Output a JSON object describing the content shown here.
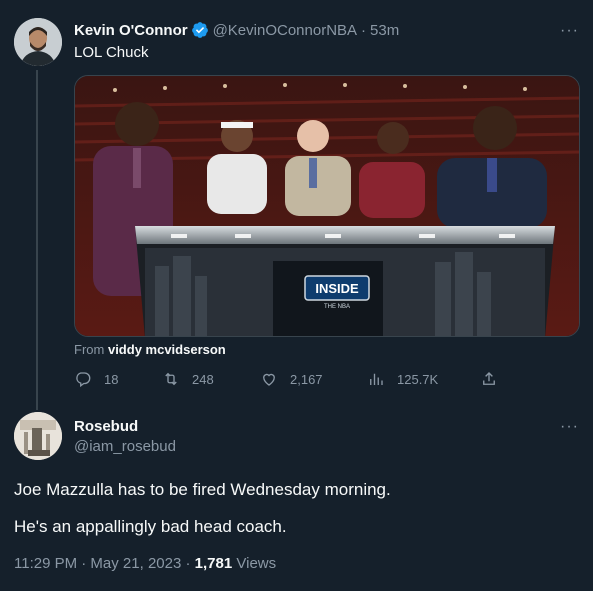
{
  "tweet1": {
    "author_name": "Kevin O'Connor",
    "handle": "@KevinOConnorNBA",
    "separator": "·",
    "time": "53m",
    "text": "LOL Chuck",
    "media_from_label": "From",
    "media_from_name": "viddy mcvidserson",
    "media_logo_text": "INSIDE",
    "media_logo_sub": "THE NBA",
    "counts": {
      "replies": "18",
      "retweets": "248",
      "likes": "2,167",
      "views": "125.7K"
    }
  },
  "tweet2": {
    "author_name": "Rosebud",
    "handle": "@iam_rosebud",
    "line1": "Joe Mazzulla has to be fired Wednesday morning.",
    "line2": "He's an appallingly bad head coach.",
    "timestamp": "11:29 PM · May 21, 2023 ·",
    "views_count": "1,781",
    "views_label": "Views"
  },
  "more_glyph": "···",
  "colors": {
    "background": "#15202b",
    "text": "#f7f9f9",
    "muted": "#8b98a5",
    "verified": "#1d9bf0",
    "border": "#38444d"
  }
}
